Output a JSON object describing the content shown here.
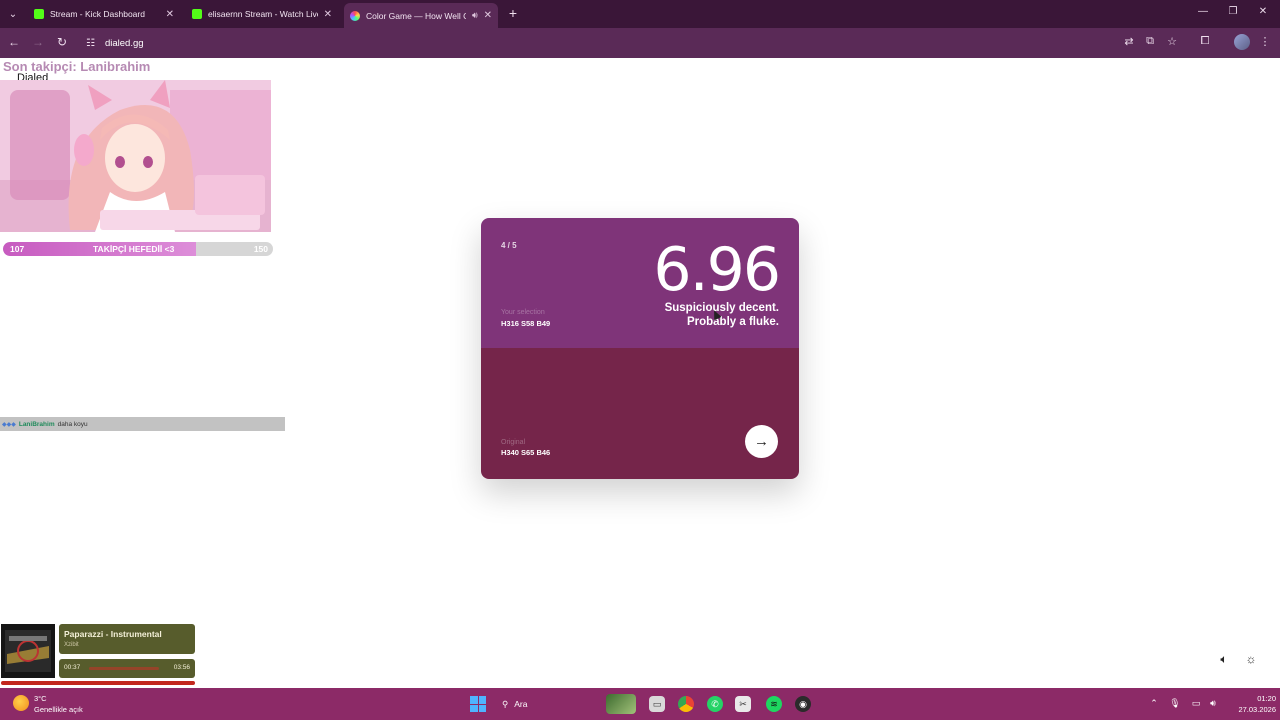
{
  "browser": {
    "tabs": [
      {
        "title": "Stream - Kick Dashboard",
        "favicon": "kick-icon",
        "active": false
      },
      {
        "title": "elisaernn Stream - Watch Live o",
        "favicon": "kick-icon",
        "active": false
      },
      {
        "title": "Color Game — How Well C",
        "favicon": "color-wheel-icon",
        "active": true,
        "audio": true
      }
    ],
    "url": "dialed.gg"
  },
  "overlay": {
    "follower_title": "Son takipçi: Lanibrahim",
    "dialed_label": "Dialed",
    "goal": {
      "current": "107",
      "label": "TAKİPÇİ HEFEDİİ <3",
      "target": "150",
      "progress": 0.713
    },
    "chat": {
      "user": "LaniBrahim",
      "message": "daha koyu"
    }
  },
  "game": {
    "round": "4 / 5",
    "score": "6.96",
    "quip_line1": "Suspiciously decent.",
    "quip_line2": "Probably a fluke.",
    "selection_label": "Your selection",
    "selection_value": "H316 S58 B49",
    "original_label": "Original",
    "original_value": "H340 S65 B46",
    "selection_color": "#7f3479",
    "original_color": "#75254a"
  },
  "music": {
    "title": "Paparazzi - Instrumental",
    "artist": "Xzibit",
    "current_time": "00:37",
    "total_time": "03:56"
  },
  "taskbar": {
    "weather_temp": "3°C",
    "weather_desc": "Genellikle açık",
    "search_placeholder": "Ara",
    "time": "01:20",
    "date": "27.03.2026"
  }
}
